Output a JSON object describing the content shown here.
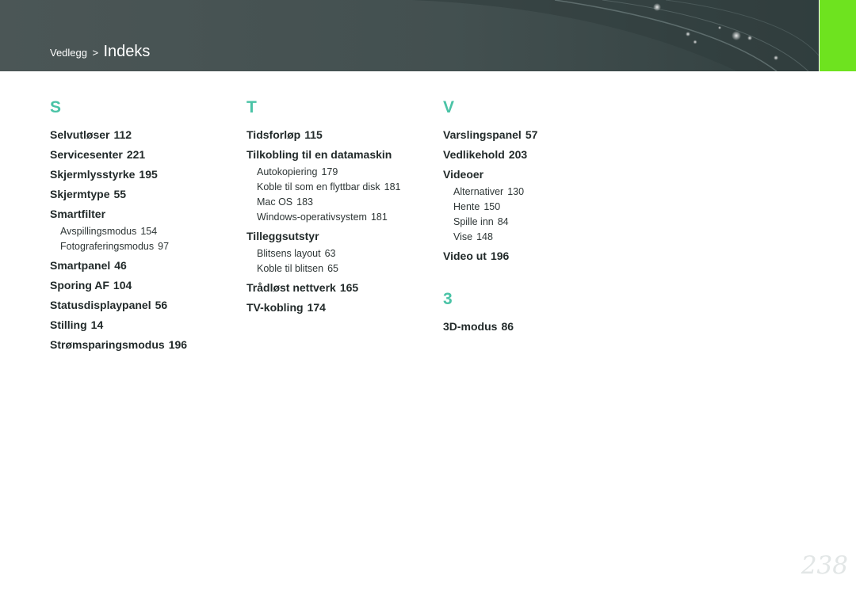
{
  "header": {
    "breadcrumb_parent": "Vedlegg",
    "breadcrumb_separator": ">",
    "breadcrumb_current": "Indeks",
    "background_color": "#435050",
    "accent_tab_color": "#6ee31f"
  },
  "index": {
    "s": {
      "letter": "S",
      "entries": [
        {
          "label": "Selvutløser",
          "page": "112"
        },
        {
          "label": "Servicesenter",
          "page": "221"
        },
        {
          "label": "Skjermlysstyrke",
          "page": "195"
        },
        {
          "label": "Skjermtype",
          "page": "55"
        },
        {
          "label": "Smartfilter",
          "page": ""
        },
        {
          "label": "Avspillingsmodus",
          "page": "154"
        },
        {
          "label": "Fotograferingsmodus",
          "page": "97"
        },
        {
          "label": "Smartpanel",
          "page": "46"
        },
        {
          "label": "Sporing AF",
          "page": "104"
        },
        {
          "label": "Statusdisplaypanel",
          "page": "56"
        },
        {
          "label": "Stilling",
          "page": "14"
        },
        {
          "label": "Strømsparingsmodus",
          "page": "196"
        }
      ]
    },
    "t": {
      "letter": "T",
      "entries": [
        {
          "label": "Tidsforløp",
          "page": "115"
        },
        {
          "label": "Tilkobling til en datamaskin",
          "page": ""
        },
        {
          "label": "Autokopiering",
          "page": "179"
        },
        {
          "label": "Koble til som en flyttbar disk",
          "page": "181"
        },
        {
          "label": "Mac OS",
          "page": "183"
        },
        {
          "label": "Windows-operativsystem",
          "page": "181"
        },
        {
          "label": "Tilleggsutstyr",
          "page": ""
        },
        {
          "label": "Blitsens layout",
          "page": "63"
        },
        {
          "label": "Koble til blitsen",
          "page": "65"
        },
        {
          "label": "Trådløst nettverk",
          "page": "165"
        },
        {
          "label": "TV-kobling",
          "page": "174"
        }
      ]
    },
    "v": {
      "letter": "V",
      "entries": [
        {
          "label": "Varslingspanel",
          "page": "57"
        },
        {
          "label": "Vedlikehold",
          "page": "203"
        },
        {
          "label": "Videoer",
          "page": ""
        },
        {
          "label": "Alternativer",
          "page": "130"
        },
        {
          "label": "Hente",
          "page": "150"
        },
        {
          "label": "Spille inn",
          "page": "84"
        },
        {
          "label": "Vise",
          "page": "148"
        },
        {
          "label": "Video ut",
          "page": "196"
        }
      ]
    },
    "three": {
      "letter": "3",
      "entries": [
        {
          "label": "3D-modus",
          "page": "86"
        }
      ]
    }
  },
  "page_number": "238"
}
